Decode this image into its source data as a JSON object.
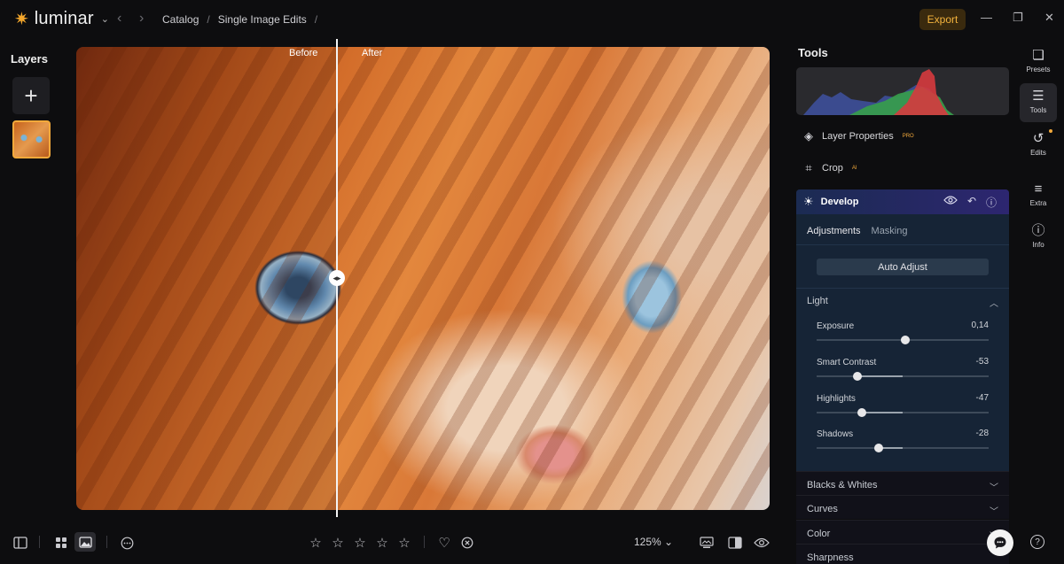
{
  "app": {
    "name": "luminar"
  },
  "breadcrumb": {
    "items": [
      "Catalog",
      "Single Image Edits"
    ]
  },
  "header": {
    "export_label": "Export"
  },
  "layers": {
    "title": "Layers",
    "add_symbol": "+"
  },
  "canvas": {
    "before_label": "Before",
    "after_label": "After",
    "split_position": 0.375
  },
  "bottombar": {
    "zoom": "125%",
    "rating_stars": 0
  },
  "tools": {
    "title": "Tools",
    "items": [
      {
        "label": "Layer Properties",
        "tag": "PRO"
      },
      {
        "label": "Crop",
        "tag": "AI"
      }
    ],
    "develop": {
      "name": "Develop",
      "tabs": [
        "Adjustments",
        "Masking"
      ],
      "auto_adjust_label": "Auto Adjust",
      "light": {
        "title": "Light",
        "sliders": [
          {
            "label": "Exposure",
            "value": "0,14",
            "numeric": 0.14,
            "min": -4,
            "max": 4
          },
          {
            "label": "Smart Contrast",
            "value": "-53",
            "numeric": -53,
            "min": -100,
            "max": 100
          },
          {
            "label": "Highlights",
            "value": "-47",
            "numeric": -47,
            "min": -100,
            "max": 100
          },
          {
            "label": "Shadows",
            "value": "-28",
            "numeric": -28,
            "min": -100,
            "max": 100
          }
        ]
      }
    },
    "sections": [
      "Blacks & Whites",
      "Curves",
      "Color",
      "Sharpness"
    ]
  },
  "rail": {
    "items": [
      {
        "label": "Presets",
        "icon": "presets-icon"
      },
      {
        "label": "Tools",
        "icon": "sliders-icon"
      },
      {
        "label": "Edits",
        "icon": "history-icon"
      },
      {
        "label": "Extra",
        "icon": "list-icon"
      },
      {
        "label": "Info",
        "icon": "info-icon"
      }
    ]
  },
  "colors": {
    "accent": "#f2a93b",
    "develop_bg": "#162436"
  }
}
